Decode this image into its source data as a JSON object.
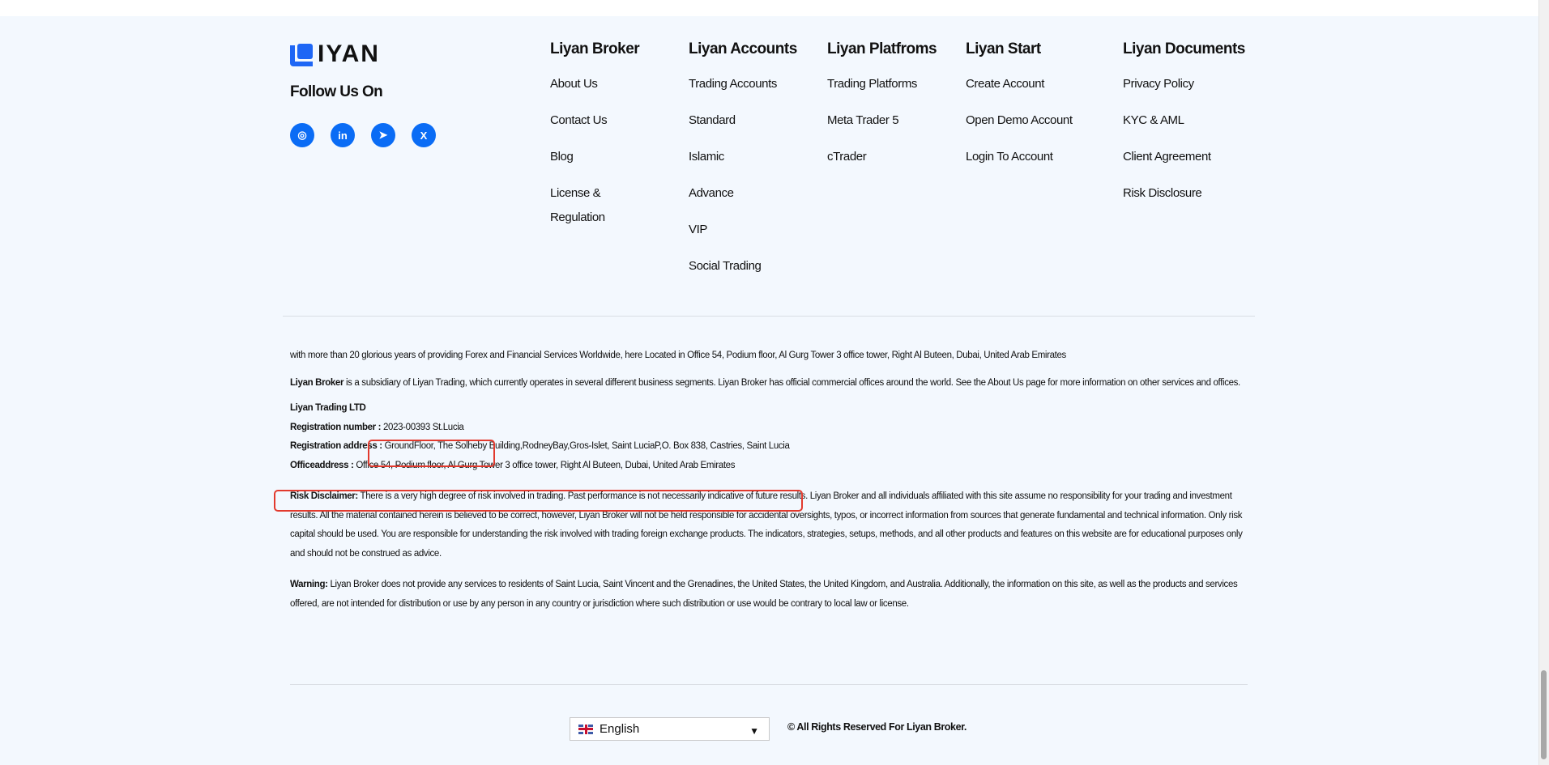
{
  "brand": {
    "logo_text": "LIYAN",
    "follow_label": "Follow Us On"
  },
  "social": [
    {
      "icon": "instagram-icon",
      "glyph": "◎"
    },
    {
      "icon": "linkedin-icon",
      "glyph": "in"
    },
    {
      "icon": "telegram-icon",
      "glyph": "➤"
    },
    {
      "icon": "x-icon",
      "glyph": "X"
    }
  ],
  "columns": [
    {
      "title": "Liyan Broker",
      "links": [
        "About Us",
        "Contact Us",
        "Blog",
        "License & Regulation"
      ]
    },
    {
      "title": "Liyan Accounts",
      "links": [
        "Trading Accounts",
        "Standard",
        "Islamic",
        "Advance",
        "VIP",
        "Social Trading"
      ]
    },
    {
      "title": "Liyan Platfroms",
      "links": [
        "Trading Platforms",
        "Meta Trader 5",
        "cTrader"
      ]
    },
    {
      "title": "Liyan Start",
      "links": [
        "Create Account",
        "Open Demo Account",
        "Login To Account"
      ]
    },
    {
      "title": "Liyan Documents",
      "links": [
        "Privacy Policy",
        "KYC & AML",
        "Client Agreement",
        "Risk Disclosure"
      ]
    }
  ],
  "info": {
    "intro": "with more than 20 glorious years of providing Forex and Financial Services Worldwide, here Located in Office 54, Podium floor, Al Gurg Tower 3 office tower, Right Al Buteen, Dubai, United Arab Emirates",
    "subsidiary_bold": "Liyan Broker",
    "subsidiary": " is a subsidiary of Liyan Trading, which currently operates in several different business segments. Liyan Broker has official commercial offices around the world. See the About Us page for more information on other services and offices.",
    "company": "Liyan Trading LTD",
    "reg_number_label": "Registration number :",
    "reg_number": " 2023-00393 St.Lucia",
    "reg_address_label": "Registration address :",
    "reg_address": " GroundFloor, The Solheby Building,RodneyBay,Gros-Islet, Saint LuciaP,O. Box 838, Castries, Saint Lucia",
    "office_label": "Officeaddress :",
    "office": " Office 54, Podium floor, Al Gurg Tower 3 office tower, Right Al Buteen, Dubai, United Arab Emirates",
    "risk_label": "Risk Disclaimer:",
    "risk": " There is a very high degree of risk involved in trading. Past performance is not necessarily indicative of future results. Liyan Broker and all individuals affiliated with this site assume no responsibility for your trading and investment results. All the material contained herein is believed to be correct, however, Liyan Broker will not be held responsible for accidental oversights, typos, or incorrect information from sources that generate fundamental and technical information. Only risk capital should be used. You are responsible for understanding the risk involved with trading foreign exchange products. The indicators, strategies, setups, methods, and all other products and features on this website are for educational purposes only and should not be construed as advice.",
    "warning_label": "Warning:",
    "warning": " Liyan Broker does not provide any services to residents of Saint Lucia, Saint Vincent and the Grenadines, the United States, the United Kingdom, and Australia. Additionally, the information on this site, as well as the products and services offered, are not intended for distribution or use by any person in any country or jurisdiction where such distribution or use would be contrary to local law or license."
  },
  "footer": {
    "language": "English",
    "copyright": "© All Rights Reserved For Liyan Broker."
  },
  "colors": {
    "accent": "#0a6cf5",
    "background": "#f3f8fe",
    "annotation": "#e23a2e"
  }
}
